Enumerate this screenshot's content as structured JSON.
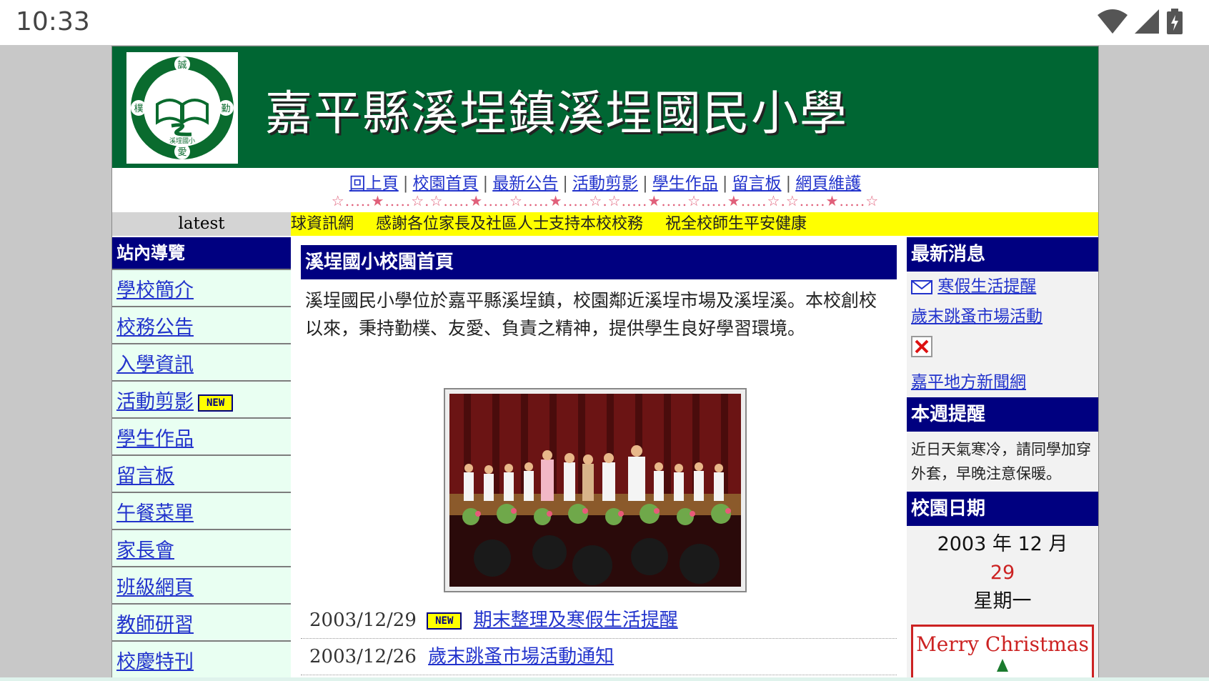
{
  "status_bar": {
    "time": "10:33"
  },
  "banner": {
    "title": "嘉平縣溪埕鎮溪埕國民小學"
  },
  "logo": {
    "top": "誠",
    "left": "樸",
    "right": "勤",
    "bottom": "愛",
    "center": "溪埕國小"
  },
  "topnav": {
    "items": [
      "回上頁",
      "校園首頁",
      "最新公告",
      "活動剪影",
      "學生作品",
      "留言板",
      "網頁維護"
    ],
    "separator": "|",
    "stars": "☆.....★.....☆.☆.....★.....☆.....★.....☆.☆.....★.....☆.....★.....☆.☆.....★.....☆"
  },
  "latest_label": "latest",
  "marquee": [
    "球資訊網",
    "感謝各位家長及社區人士支持本校校務",
    "祝全校師生平安健康"
  ],
  "left_nav": {
    "heading": "站內導覽",
    "items": [
      {
        "label": "學校簡介",
        "badge": ""
      },
      {
        "label": "校務公告",
        "badge": ""
      },
      {
        "label": "入學資訊",
        "badge": ""
      },
      {
        "label": "活動剪影",
        "badge": "NEW"
      },
      {
        "label": "學生作品",
        "badge": ""
      },
      {
        "label": "留言板",
        "badge": ""
      },
      {
        "label": "午餐菜單",
        "badge": ""
      },
      {
        "label": "家長會",
        "badge": ""
      },
      {
        "label": "班級網頁",
        "badge": ""
      },
      {
        "label": "教師研習",
        "badge": ""
      },
      {
        "label": "校慶特刊",
        "badge": ""
      }
    ]
  },
  "main": {
    "heading": "溪埕國小校園首頁",
    "intro": "溪埕國民小學位於嘉平縣溪埕鎮，校園鄰近溪埕市場及溪埕溪。本校創校以來，秉持勤樸、友愛、負責之精神，提供學生良好學習環境。",
    "news": [
      {
        "date": "2003/12/29",
        "badge": "NEW",
        "title": "期末整理及寒假生活提醒"
      },
      {
        "date": "2003/12/26",
        "badge": "",
        "title": "歲末跳蚤市場活動通知"
      }
    ]
  },
  "right": {
    "news_heading": "最新消息",
    "news_links": [
      "寒假生活提醒",
      "歲末跳蚤市場活動",
      "嘉平地方新聞網"
    ],
    "week_heading": "本週提醒",
    "week_text": "近日天氣寒冷，請同學加穿外套，早晚注意保暖。",
    "cal_heading": "校園日期",
    "cal_month": "2003 年 12 月",
    "cal_day": "29",
    "cal_weekday": "星期一",
    "xmas": "Merry Christmas"
  },
  "colors": {
    "banner": "#006633",
    "heading_bg": "#000080",
    "marquee_bg": "#ffff00",
    "link": "#2233cc"
  }
}
